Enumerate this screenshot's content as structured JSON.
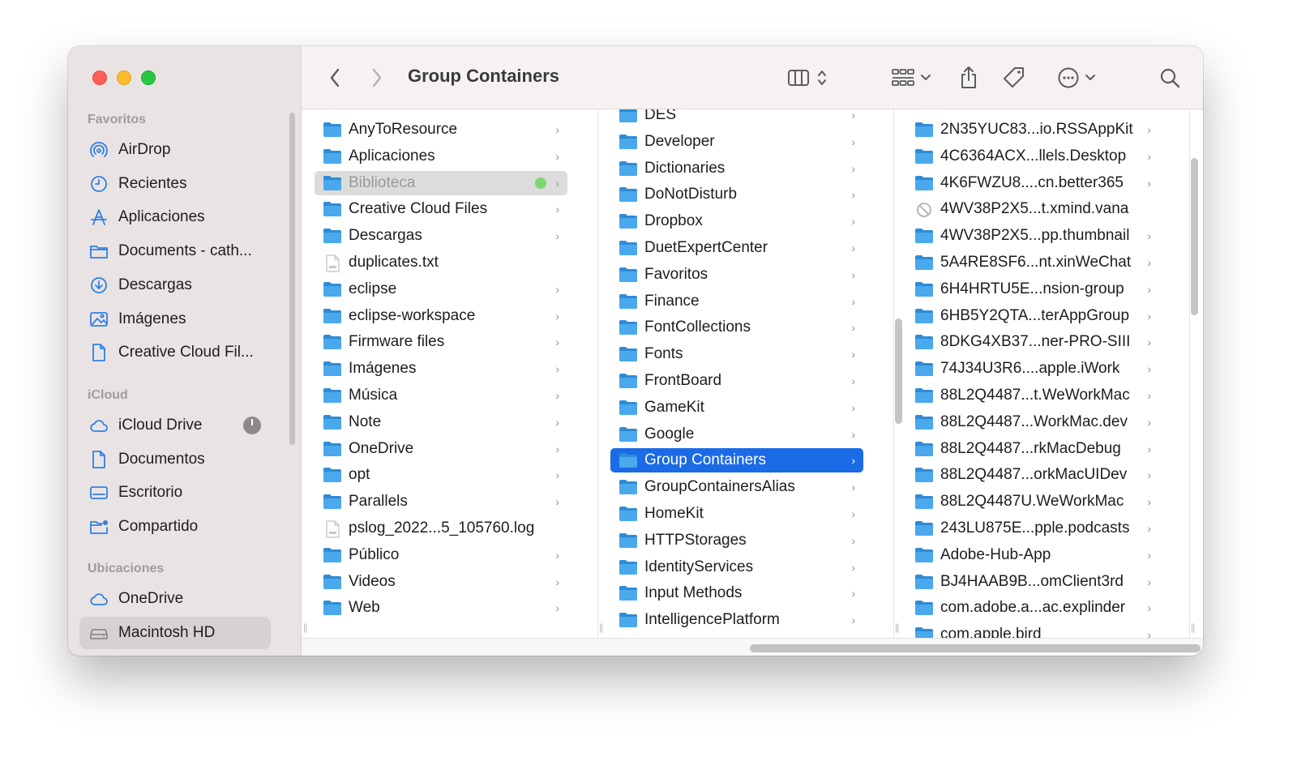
{
  "window": {
    "title": "Group Containers"
  },
  "sidebar": {
    "sections": [
      {
        "label": "Favoritos",
        "items": [
          {
            "label": "AirDrop",
            "icon": "airdrop-icon"
          },
          {
            "label": "Recientes",
            "icon": "clock-icon"
          },
          {
            "label": "Aplicaciones",
            "icon": "applications-icon"
          },
          {
            "label": "Documents - cath...",
            "icon": "folder-icon"
          },
          {
            "label": "Descargas",
            "icon": "download-icon"
          },
          {
            "label": "Imágenes",
            "icon": "photo-icon"
          },
          {
            "label": "Creative Cloud Fil...",
            "icon": "document-icon"
          }
        ]
      },
      {
        "label": "iCloud",
        "items": [
          {
            "label": "iCloud Drive",
            "icon": "cloud-icon"
          },
          {
            "label": "Documentos",
            "icon": "document-icon"
          },
          {
            "label": "Escritorio",
            "icon": "desktop-icon"
          },
          {
            "label": "Compartido",
            "icon": "shared-folder-icon"
          }
        ]
      },
      {
        "label": "Ubicaciones",
        "items": [
          {
            "label": "OneDrive",
            "icon": "cloud-icon"
          },
          {
            "label": "Macintosh HD",
            "icon": "disk-icon",
            "selected": true
          }
        ]
      }
    ]
  },
  "columns": [
    {
      "items": [
        {
          "name": "AnyToResource",
          "type": "folder",
          "chevron": true
        },
        {
          "name": "Aplicaciones",
          "type": "folder",
          "chevron": true
        },
        {
          "name": "Biblioteca",
          "type": "folder",
          "chevron": true,
          "state": "dim",
          "tag": "green"
        },
        {
          "name": "Creative Cloud Files",
          "type": "folder",
          "chevron": true
        },
        {
          "name": "Descargas",
          "type": "folder",
          "chevron": true
        },
        {
          "name": "duplicates.txt",
          "type": "file",
          "chevron": false
        },
        {
          "name": "eclipse",
          "type": "folder",
          "chevron": true
        },
        {
          "name": "eclipse-workspace",
          "type": "folder",
          "chevron": true
        },
        {
          "name": "Firmware files",
          "type": "folder",
          "chevron": true
        },
        {
          "name": "Imágenes",
          "type": "folder",
          "chevron": true
        },
        {
          "name": "Música",
          "type": "folder",
          "chevron": true
        },
        {
          "name": "Note",
          "type": "folder",
          "chevron": true
        },
        {
          "name": "OneDrive",
          "type": "folder",
          "chevron": true
        },
        {
          "name": "opt",
          "type": "folder",
          "chevron": true
        },
        {
          "name": "Parallels",
          "type": "folder",
          "chevron": true
        },
        {
          "name": "pslog_2022...5_105760.log",
          "type": "file",
          "chevron": false
        },
        {
          "name": "Público",
          "type": "folder",
          "chevron": true
        },
        {
          "name": "Videos",
          "type": "folder",
          "chevron": true
        },
        {
          "name": "Web",
          "type": "folder",
          "chevron": true
        }
      ]
    },
    {
      "items": [
        {
          "name": "DES",
          "type": "folder",
          "chevron": true
        },
        {
          "name": "Developer",
          "type": "folder",
          "chevron": true
        },
        {
          "name": "Dictionaries",
          "type": "folder",
          "chevron": true
        },
        {
          "name": "DoNotDisturb",
          "type": "folder",
          "chevron": true
        },
        {
          "name": "Dropbox",
          "type": "folder",
          "chevron": true
        },
        {
          "name": "DuetExpertCenter",
          "type": "folder",
          "chevron": true
        },
        {
          "name": "Favoritos",
          "type": "folder",
          "chevron": true
        },
        {
          "name": "Finance",
          "type": "folder",
          "chevron": true
        },
        {
          "name": "FontCollections",
          "type": "folder",
          "chevron": true
        },
        {
          "name": "Fonts",
          "type": "folder",
          "chevron": true
        },
        {
          "name": "FrontBoard",
          "type": "folder",
          "chevron": true
        },
        {
          "name": "GameKit",
          "type": "folder",
          "chevron": true
        },
        {
          "name": "Google",
          "type": "folder",
          "chevron": true
        },
        {
          "name": "Group Containers",
          "type": "folder",
          "chevron": true,
          "state": "active"
        },
        {
          "name": "GroupContainersAlias",
          "type": "folder",
          "chevron": true
        },
        {
          "name": "HomeKit",
          "type": "folder",
          "chevron": true
        },
        {
          "name": "HTTPStorages",
          "type": "folder",
          "chevron": true
        },
        {
          "name": "IdentityServices",
          "type": "folder",
          "chevron": true
        },
        {
          "name": "Input Methods",
          "type": "folder",
          "chevron": true
        },
        {
          "name": "IntelligencePlatform",
          "type": "folder",
          "chevron": true
        }
      ]
    },
    {
      "items": [
        {
          "name": "2N35YUC83...io.RSSAppKit",
          "type": "folder",
          "chevron": true
        },
        {
          "name": "4C6364ACX...llels.Desktop",
          "type": "folder",
          "chevron": true
        },
        {
          "name": "4K6FWZU8....cn.better365",
          "type": "folder",
          "chevron": true
        },
        {
          "name": "4WV38P2X5...t.xmind.vana",
          "type": "blocked",
          "chevron": false
        },
        {
          "name": "4WV38P2X5...pp.thumbnail",
          "type": "folder",
          "chevron": true
        },
        {
          "name": "5A4RE8SF6...nt.xinWeChat",
          "type": "folder",
          "chevron": true
        },
        {
          "name": "6H4HRTU5E...nsion-group",
          "type": "folder",
          "chevron": true
        },
        {
          "name": "6HB5Y2QTA...terAppGroup",
          "type": "folder",
          "chevron": true
        },
        {
          "name": "8DKG4XB37...ner-PRO-SIII",
          "type": "folder",
          "chevron": true
        },
        {
          "name": "74J34U3R6....apple.iWork",
          "type": "folder",
          "chevron": true
        },
        {
          "name": "88L2Q4487...t.WeWorkMac",
          "type": "folder",
          "chevron": true
        },
        {
          "name": "88L2Q4487...WorkMac.dev",
          "type": "folder",
          "chevron": true
        },
        {
          "name": "88L2Q4487...rkMacDebug",
          "type": "folder",
          "chevron": true
        },
        {
          "name": "88L2Q4487...orkMacUIDev",
          "type": "folder",
          "chevron": true
        },
        {
          "name": "88L2Q4487U.WeWorkMac",
          "type": "folder",
          "chevron": true
        },
        {
          "name": "243LU875E...pple.podcasts",
          "type": "folder",
          "chevron": true
        },
        {
          "name": "Adobe-Hub-App",
          "type": "folder",
          "chevron": true
        },
        {
          "name": "BJ4HAAB9B...omClient3rd",
          "type": "folder",
          "chevron": true
        },
        {
          "name": "com.adobe.a...ac.explinder",
          "type": "folder",
          "chevron": true
        },
        {
          "name": "com.apple.bird",
          "type": "folder",
          "chevron": true
        }
      ]
    }
  ],
  "colors": {
    "accent": "#1b6ae6",
    "folder": "#4aa8ec",
    "folderDark": "#2f8bd6"
  }
}
